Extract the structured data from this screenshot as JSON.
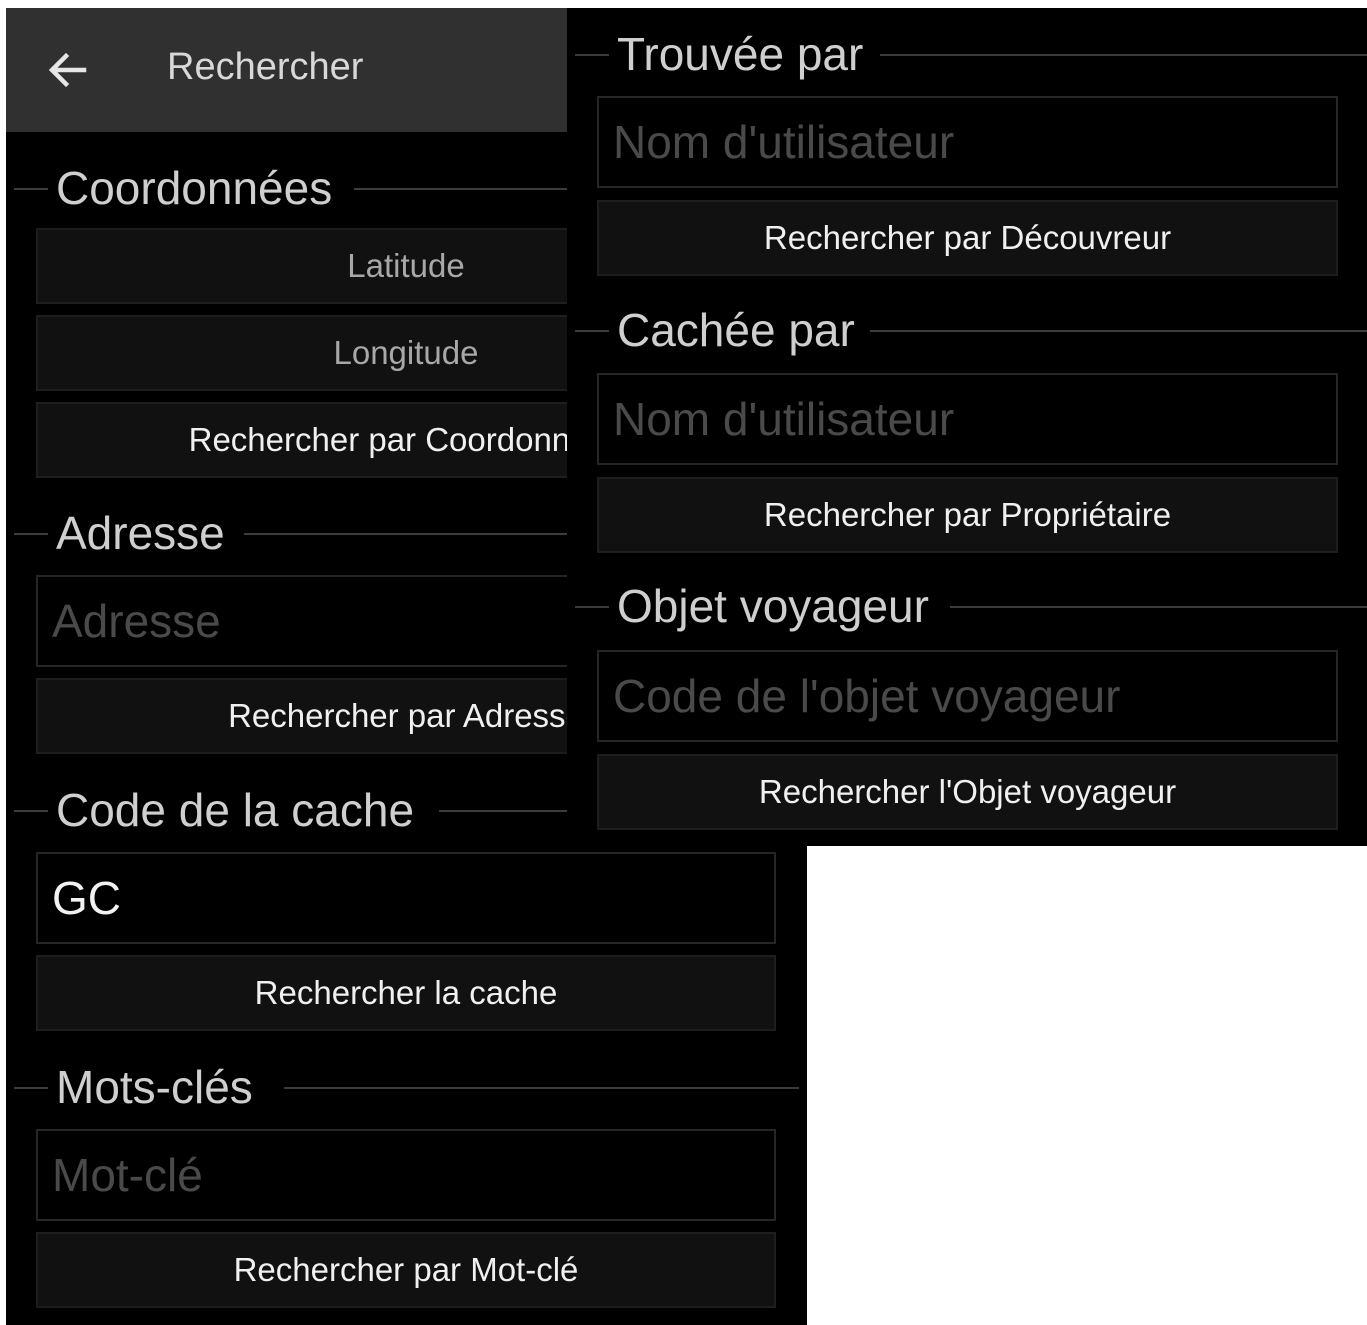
{
  "toolbar": {
    "title": "Rechercher",
    "back_icon": "arrow-left-icon"
  },
  "coordinates": {
    "title": "Coordonnées",
    "latitude_label": "Latitude",
    "longitude_label": "Longitude",
    "search_label": "Rechercher par Coordonnées"
  },
  "address": {
    "title": "Adresse",
    "placeholder": "Adresse",
    "search_label": "Rechercher par Adresse"
  },
  "cache_code": {
    "title": "Code de la cache",
    "value": "GC",
    "search_label": "Rechercher la cache"
  },
  "keywords": {
    "title": "Mots-clés",
    "placeholder": "Mot-clé",
    "search_label": "Rechercher par Mot-clé"
  },
  "found_by": {
    "title": "Trouvée par",
    "placeholder": "Nom d'utilisateur",
    "search_label": "Rechercher par Découvreur"
  },
  "hidden_by": {
    "title": "Cachée par",
    "placeholder": "Nom d'utilisateur",
    "search_label": "Rechercher par Propriétaire"
  },
  "trackable": {
    "title": "Objet voyageur",
    "placeholder": "Code de l'objet voyageur",
    "search_label": "Rechercher l'Objet voyageur"
  }
}
